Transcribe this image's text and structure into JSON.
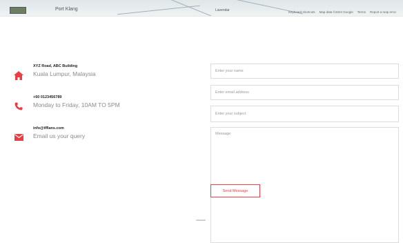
{
  "map": {
    "place_label": "Port Klang",
    "small_label": "Lavendar",
    "footer_links": [
      "Keyboard shortcuts",
      "Map data ©2024 Google",
      "Terms",
      "Report a map error"
    ]
  },
  "contact": {
    "items": [
      {
        "icon": "home-icon",
        "title": "XYZ Road, ABC Building",
        "sub": "Kuala Lumpur, Malaysia"
      },
      {
        "icon": "phone-icon",
        "title": "+60 0123456789",
        "sub": "Monday to Friday, 10AM TO 5PM"
      },
      {
        "icon": "envelope-icon",
        "title": "info@tfflans.com",
        "sub": "Email us your query"
      }
    ]
  },
  "form": {
    "name_placeholder": "Enter your name",
    "email_placeholder": "Enter email address",
    "subject_placeholder": "Enter your subject",
    "message_placeholder": "Message",
    "send_label": "Send Message"
  },
  "colors": {
    "accent": "#e83e44"
  }
}
